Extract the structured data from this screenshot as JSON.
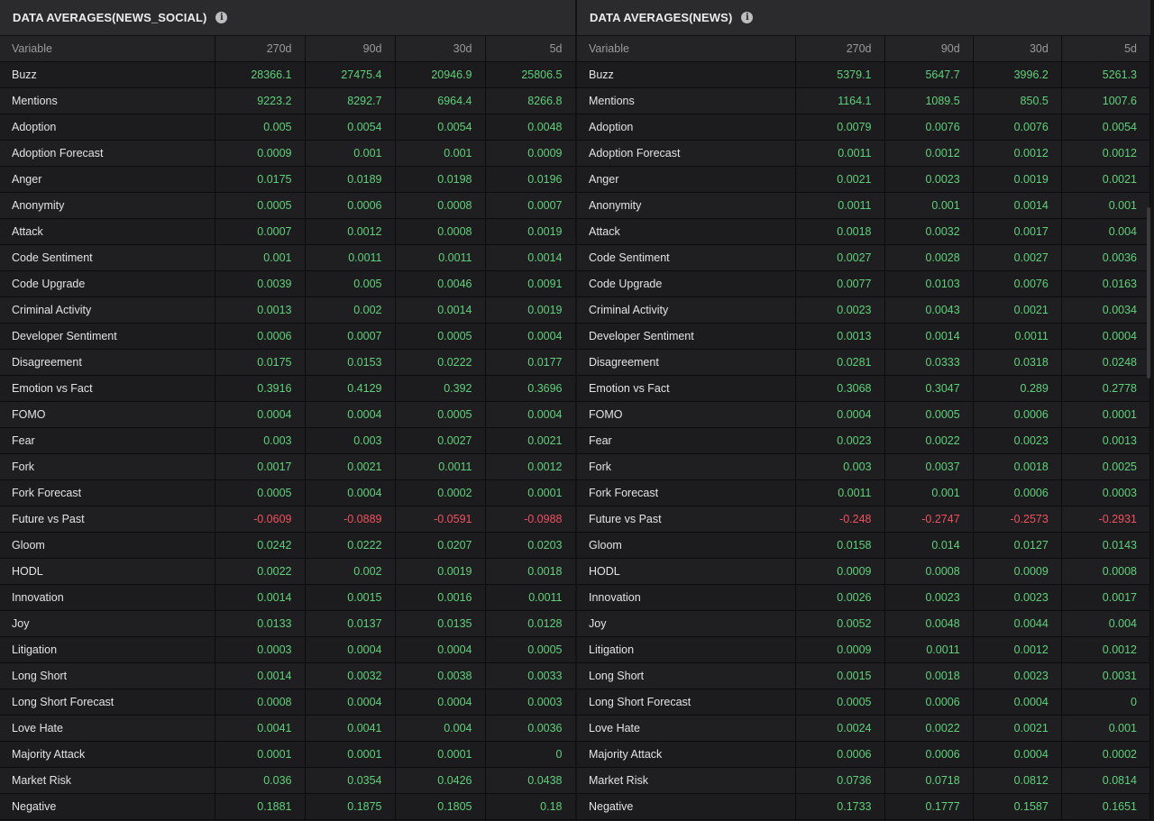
{
  "panels": [
    {
      "title": "DATA AVERAGES(NEWS_SOCIAL)",
      "columns": [
        "Variable",
        "270d",
        "90d",
        "30d",
        "5d"
      ],
      "rows": [
        [
          "Buzz",
          "28366.1",
          "27475.4",
          "20946.9",
          "25806.5"
        ],
        [
          "Mentions",
          "9223.2",
          "8292.7",
          "6964.4",
          "8266.8"
        ],
        [
          "Adoption",
          "0.005",
          "0.0054",
          "0.0054",
          "0.0048"
        ],
        [
          "Adoption Forecast",
          "0.0009",
          "0.001",
          "0.001",
          "0.0009"
        ],
        [
          "Anger",
          "0.0175",
          "0.0189",
          "0.0198",
          "0.0196"
        ],
        [
          "Anonymity",
          "0.0005",
          "0.0006",
          "0.0008",
          "0.0007"
        ],
        [
          "Attack",
          "0.0007",
          "0.0012",
          "0.0008",
          "0.0019"
        ],
        [
          "Code Sentiment",
          "0.001",
          "0.0011",
          "0.0011",
          "0.0014"
        ],
        [
          "Code Upgrade",
          "0.0039",
          "0.005",
          "0.0046",
          "0.0091"
        ],
        [
          "Criminal Activity",
          "0.0013",
          "0.002",
          "0.0014",
          "0.0019"
        ],
        [
          "Developer Sentiment",
          "0.0006",
          "0.0007",
          "0.0005",
          "0.0004"
        ],
        [
          "Disagreement",
          "0.0175",
          "0.0153",
          "0.0222",
          "0.0177"
        ],
        [
          "Emotion vs Fact",
          "0.3916",
          "0.4129",
          "0.392",
          "0.3696"
        ],
        [
          "FOMO",
          "0.0004",
          "0.0004",
          "0.0005",
          "0.0004"
        ],
        [
          "Fear",
          "0.003",
          "0.003",
          "0.0027",
          "0.0021"
        ],
        [
          "Fork",
          "0.0017",
          "0.0021",
          "0.0011",
          "0.0012"
        ],
        [
          "Fork Forecast",
          "0.0005",
          "0.0004",
          "0.0002",
          "0.0001"
        ],
        [
          "Future vs Past",
          "-0.0609",
          "-0.0889",
          "-0.0591",
          "-0.0988"
        ],
        [
          "Gloom",
          "0.0242",
          "0.0222",
          "0.0207",
          "0.0203"
        ],
        [
          "HODL",
          "0.0022",
          "0.002",
          "0.0019",
          "0.0018"
        ],
        [
          "Innovation",
          "0.0014",
          "0.0015",
          "0.0016",
          "0.0011"
        ],
        [
          "Joy",
          "0.0133",
          "0.0137",
          "0.0135",
          "0.0128"
        ],
        [
          "Litigation",
          "0.0003",
          "0.0004",
          "0.0004",
          "0.0005"
        ],
        [
          "Long Short",
          "0.0014",
          "0.0032",
          "0.0038",
          "0.0033"
        ],
        [
          "Long Short Forecast",
          "0.0008",
          "0.0004",
          "0.0004",
          "0.0003"
        ],
        [
          "Love Hate",
          "0.0041",
          "0.0041",
          "0.004",
          "0.0036"
        ],
        [
          "Majority Attack",
          "0.0001",
          "0.0001",
          "0.0001",
          "0"
        ],
        [
          "Market Risk",
          "0.036",
          "0.0354",
          "0.0426",
          "0.0438"
        ],
        [
          "Negative",
          "0.1881",
          "0.1875",
          "0.1805",
          "0.18"
        ]
      ]
    },
    {
      "title": "DATA AVERAGES(NEWS)",
      "columns": [
        "Variable",
        "270d",
        "90d",
        "30d",
        "5d"
      ],
      "rows": [
        [
          "Buzz",
          "5379.1",
          "5647.7",
          "3996.2",
          "5261.3"
        ],
        [
          "Mentions",
          "1164.1",
          "1089.5",
          "850.5",
          "1007.6"
        ],
        [
          "Adoption",
          "0.0079",
          "0.0076",
          "0.0076",
          "0.0054"
        ],
        [
          "Adoption Forecast",
          "0.0011",
          "0.0012",
          "0.0012",
          "0.0012"
        ],
        [
          "Anger",
          "0.0021",
          "0.0023",
          "0.0019",
          "0.0021"
        ],
        [
          "Anonymity",
          "0.0011",
          "0.001",
          "0.0014",
          "0.001"
        ],
        [
          "Attack",
          "0.0018",
          "0.0032",
          "0.0017",
          "0.004"
        ],
        [
          "Code Sentiment",
          "0.0027",
          "0.0028",
          "0.0027",
          "0.0036"
        ],
        [
          "Code Upgrade",
          "0.0077",
          "0.0103",
          "0.0076",
          "0.0163"
        ],
        [
          "Criminal Activity",
          "0.0023",
          "0.0043",
          "0.0021",
          "0.0034"
        ],
        [
          "Developer Sentiment",
          "0.0013",
          "0.0014",
          "0.0011",
          "0.0004"
        ],
        [
          "Disagreement",
          "0.0281",
          "0.0333",
          "0.0318",
          "0.0248"
        ],
        [
          "Emotion vs Fact",
          "0.3068",
          "0.3047",
          "0.289",
          "0.2778"
        ],
        [
          "FOMO",
          "0.0004",
          "0.0005",
          "0.0006",
          "0.0001"
        ],
        [
          "Fear",
          "0.0023",
          "0.0022",
          "0.0023",
          "0.0013"
        ],
        [
          "Fork",
          "0.003",
          "0.0037",
          "0.0018",
          "0.0025"
        ],
        [
          "Fork Forecast",
          "0.0011",
          "0.001",
          "0.0006",
          "0.0003"
        ],
        [
          "Future vs Past",
          "-0.248",
          "-0.2747",
          "-0.2573",
          "-0.2931"
        ],
        [
          "Gloom",
          "0.0158",
          "0.014",
          "0.0127",
          "0.0143"
        ],
        [
          "HODL",
          "0.0009",
          "0.0008",
          "0.0009",
          "0.0008"
        ],
        [
          "Innovation",
          "0.0026",
          "0.0023",
          "0.0023",
          "0.0017"
        ],
        [
          "Joy",
          "0.0052",
          "0.0048",
          "0.0044",
          "0.004"
        ],
        [
          "Litigation",
          "0.0009",
          "0.0011",
          "0.0012",
          "0.0012"
        ],
        [
          "Long Short",
          "0.0015",
          "0.0018",
          "0.0023",
          "0.0031"
        ],
        [
          "Long Short Forecast",
          "0.0005",
          "0.0006",
          "0.0004",
          "0"
        ],
        [
          "Love Hate",
          "0.0024",
          "0.0022",
          "0.0021",
          "0.001"
        ],
        [
          "Majority Attack",
          "0.0006",
          "0.0006",
          "0.0004",
          "0.0002"
        ],
        [
          "Market Risk",
          "0.0736",
          "0.0718",
          "0.0812",
          "0.0814"
        ],
        [
          "Negative",
          "0.1733",
          "0.1777",
          "0.1587",
          "0.1651"
        ]
      ]
    }
  ],
  "colors": {
    "positive": "#5fd17a",
    "negative": "#f0515f"
  },
  "icons": {
    "info": "info-icon"
  }
}
